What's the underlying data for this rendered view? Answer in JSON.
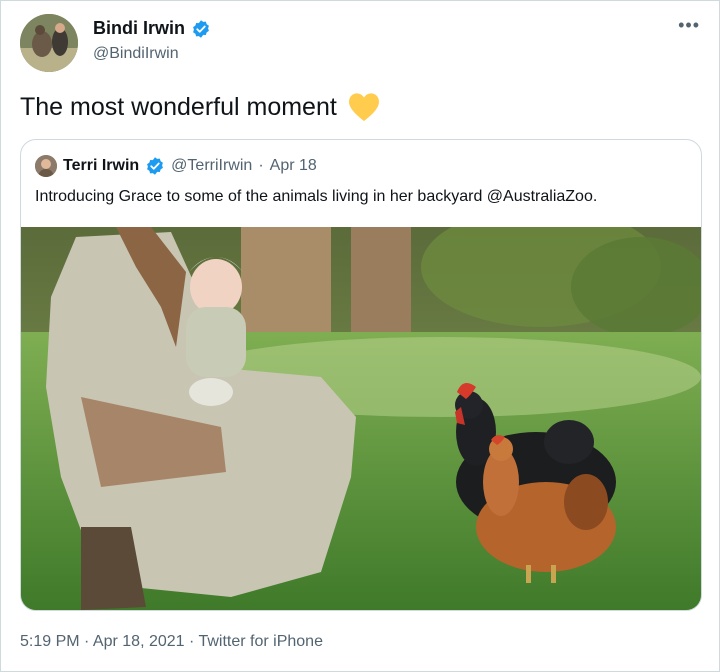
{
  "tweet": {
    "author": {
      "name": "Bindi Irwin",
      "handle": "@BindiIrwin",
      "verified": true,
      "avatar_icon": "avatar-kangaroo-photo"
    },
    "text": "The most wonderful moment",
    "emoji_icon": "yellow-heart-icon",
    "more_label": "•••",
    "quoted": {
      "name": "Terri Irwin",
      "handle": "@TerriIrwin",
      "separator": " · ",
      "date": "Apr 18",
      "verified": true,
      "text": "Introducing Grace to some of the animals living in her backyard @AustraliaZoo.",
      "media_icon": "photo-woman-baby-chickens"
    },
    "footer": "5:19 PM · Apr 18, 2021 · Twitter for iPhone"
  },
  "colors": {
    "text": "#0f1419",
    "secondary": "#536471",
    "verified": "#1d9bf0",
    "border": "#cfd9de",
    "heart": "#ffcc4d"
  }
}
